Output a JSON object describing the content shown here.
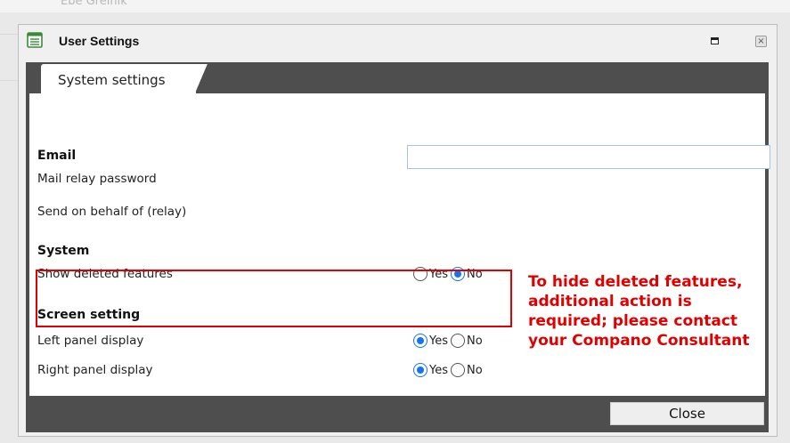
{
  "background": {
    "behind_text": "Ebe Greinik"
  },
  "dialog": {
    "title": "User Settings",
    "icons": {
      "title": "list-window-icon",
      "maximize": "maximize-icon",
      "close": "close-icon"
    }
  },
  "tabs": [
    {
      "label": "System settings",
      "active": true
    }
  ],
  "sections": {
    "email": {
      "title": "Email",
      "mail_relay_password": {
        "label": "Mail relay password",
        "value": "",
        "placeholder": ""
      },
      "send_on_behalf": {
        "label": "Send on behalf of (relay)"
      }
    },
    "system": {
      "title": "System",
      "show_deleted_features": {
        "label": "Show deleted features",
        "selected": "No"
      }
    },
    "screen": {
      "title": "Screen setting",
      "left_panel_display": {
        "label": "Left panel display",
        "selected": "Yes"
      },
      "right_panel_display": {
        "label": "Right panel display",
        "selected": "Yes"
      }
    }
  },
  "radio_options": {
    "yes": "Yes",
    "no": "No"
  },
  "annotation": {
    "text": "To hide deleted features, additional action is required; please contact your Compano Consultant",
    "color": "#e00000"
  },
  "footer": {
    "close_label": "Close"
  },
  "colors": {
    "frame": "#4e4e4e",
    "accent": "#1a73e8",
    "highlight": "#e00000"
  }
}
